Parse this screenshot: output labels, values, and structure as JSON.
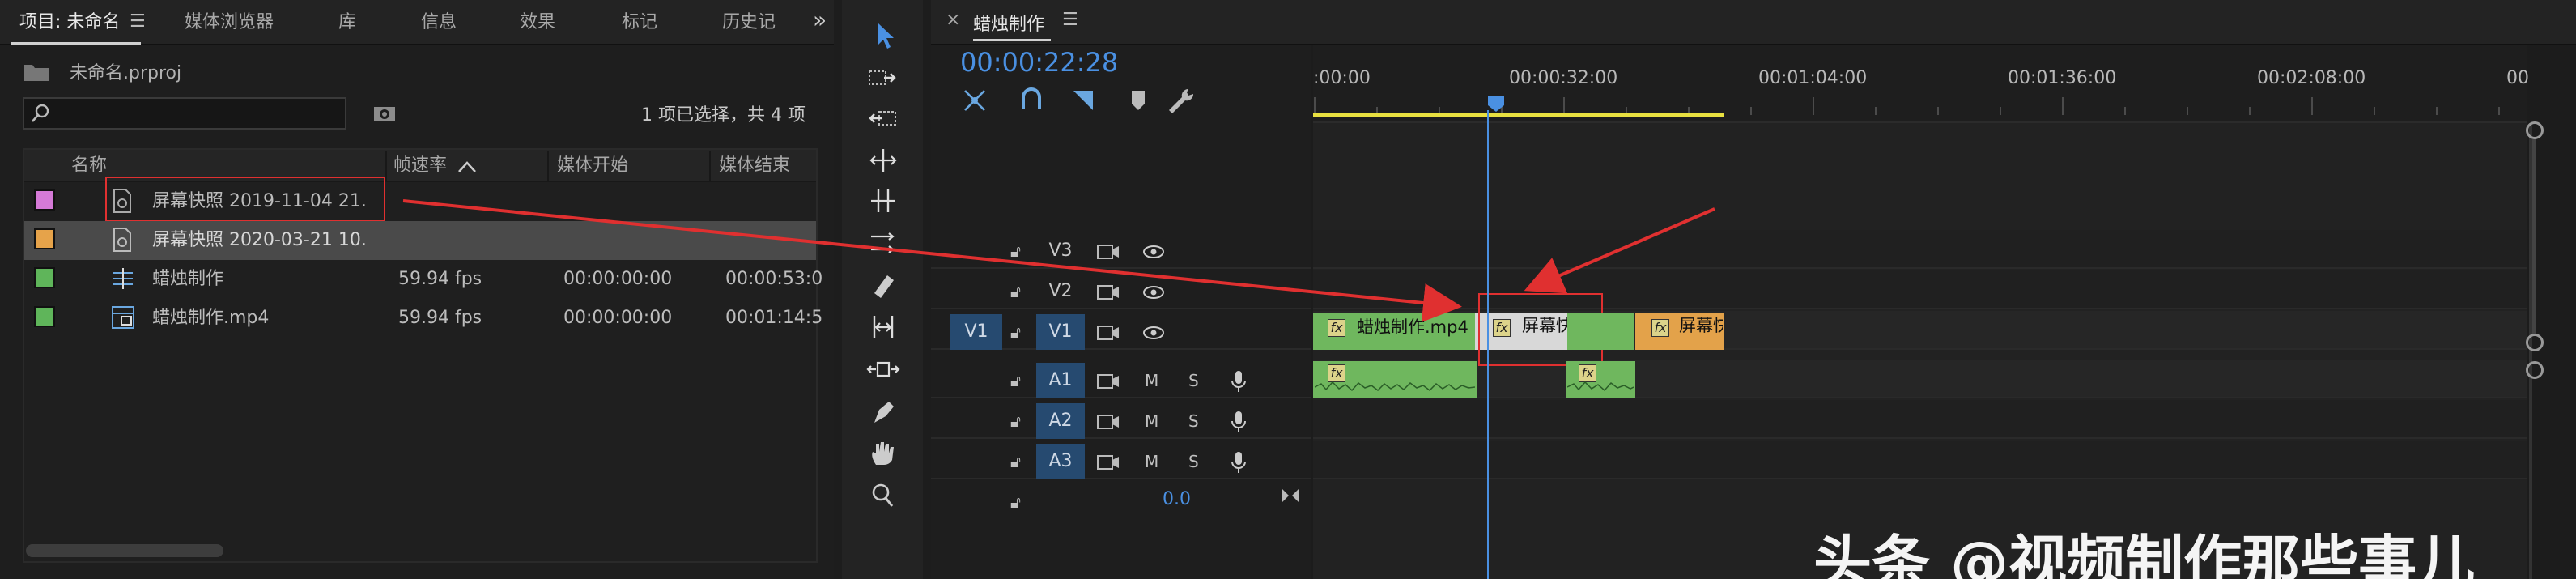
{
  "project_panel": {
    "tabs": [
      "项目: 未命名",
      "媒体浏览器",
      "库",
      "信息",
      "效果",
      "标记",
      "历史记"
    ],
    "overflow_icon": "double-chevron-right-icon",
    "file_name": "未命名.prproj",
    "selection_status": "1 项已选择，共 4 项",
    "search_placeholder": "",
    "columns": [
      "名称",
      "帧速率",
      "媒体开始",
      "媒体结束"
    ],
    "items": [
      {
        "name": "屏幕快照 2019-11-04 21.",
        "fps": "",
        "start": "",
        "end": "",
        "color": "#d57ad7",
        "icon": "still-image-icon"
      },
      {
        "name": "屏幕快照 2020-03-21 10.",
        "fps": "",
        "start": "",
        "end": "",
        "color": "#e6a34a",
        "icon": "still-image-icon"
      },
      {
        "name": "蜡烛制作",
        "fps": "59.94 fps",
        "start": "00:00:00:00",
        "end": "00:00:53:0",
        "color": "#5fb55a",
        "icon": "sequence-icon"
      },
      {
        "name": "蜡烛制作.mp4",
        "fps": "59.94 fps",
        "start": "00:00:00:00",
        "end": "00:01:14:5",
        "color": "#5fb55a",
        "icon": "video-file-icon"
      }
    ]
  },
  "timeline": {
    "sequence_name": "蜡烛制作",
    "timecode": "00:00:22:28",
    "ruler_labels": [
      ":00:00",
      "00:00:32:00",
      "00:01:04:00",
      "00:01:36:00",
      "00:02:08:00",
      "00"
    ],
    "tracks": {
      "video": [
        "V3",
        "V2",
        "V1"
      ],
      "audio": [
        "A1",
        "A2",
        "A3"
      ],
      "source_patch_v": "V1",
      "mute": "M",
      "solo": "S"
    },
    "master_volume": "0.0",
    "clips": {
      "v1_main": "蜡烛制作.mp4",
      "v1_snap1": "屏幕快照",
      "v1_snap2": "屏幕快",
      "fx": "fx"
    }
  },
  "colors": {
    "accent_blue": "#4a90e2",
    "clip_green": "#6fb75e",
    "clip_orange": "#e3a24a",
    "annotation_red": "#e03030",
    "work_area_yellow": "#e8e040"
  },
  "watermark": "头条 @视频制作那些事儿"
}
